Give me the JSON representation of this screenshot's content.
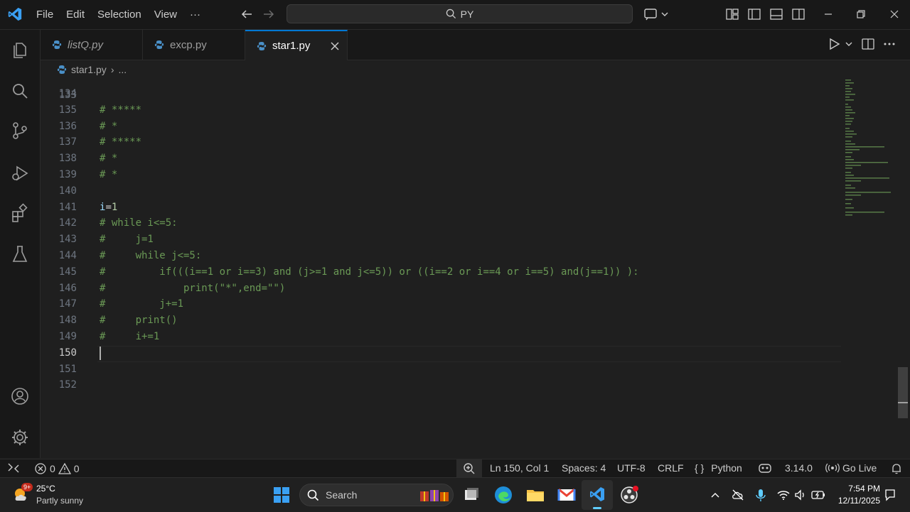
{
  "titlebar": {
    "menu": [
      "File",
      "Edit",
      "Selection",
      "View",
      "···"
    ],
    "search_text": "PY"
  },
  "tabs": [
    {
      "label": "listQ.py",
      "italic": true,
      "active": false
    },
    {
      "label": "excp.py",
      "italic": false,
      "active": false
    },
    {
      "label": "star1.py",
      "italic": false,
      "active": true
    }
  ],
  "breadcrumb": {
    "file": "star1.py",
    "sep": "›",
    "more": "..."
  },
  "editor": {
    "partial_top_line": "133",
    "lines": [
      {
        "n": "134",
        "text": ""
      },
      {
        "n": "135",
        "text": "# *****"
      },
      {
        "n": "136",
        "text": "# *"
      },
      {
        "n": "137",
        "text": "# *****"
      },
      {
        "n": "138",
        "text": "# *"
      },
      {
        "n": "139",
        "text": "# *"
      },
      {
        "n": "140",
        "text": ""
      },
      {
        "n": "141",
        "text": "i=1"
      },
      {
        "n": "142",
        "text": "# while i<=5:"
      },
      {
        "n": "143",
        "text": "#     j=1"
      },
      {
        "n": "144",
        "text": "#     while j<=5:"
      },
      {
        "n": "145",
        "text": "#         if(((i==1 or i==3) and (j>=1 and j<=5)) or ((i==2 or i==4 or i==5) and(j==1)) ):"
      },
      {
        "n": "146",
        "text": "#             print(\"*\",end=\"\")"
      },
      {
        "n": "147",
        "text": "#         j+=1"
      },
      {
        "n": "148",
        "text": "#     print()"
      },
      {
        "n": "149",
        "text": "#     i+=1"
      },
      {
        "n": "150",
        "text": ""
      },
      {
        "n": "151",
        "text": ""
      },
      {
        "n": "152",
        "text": ""
      }
    ],
    "current_line": "150"
  },
  "status": {
    "errors": "0",
    "warnings": "0",
    "position": "Ln 150, Col 1",
    "spaces": "Spaces: 4",
    "encoding": "UTF-8",
    "eol": "CRLF",
    "language_braces": "{ }",
    "language": "Python",
    "version": "3.14.0",
    "golive": "Go Live"
  },
  "taskbar": {
    "weather_badge": "9+",
    "temperature": "25°C",
    "weather": "Partly sunny",
    "search_placeholder": "Search",
    "time": "7:54 PM",
    "date": "12/11/2025"
  },
  "colors": {
    "accent": "#0078d4",
    "comment": "#6a9955",
    "variable": "#9cdcfe",
    "number": "#b5cea8"
  }
}
